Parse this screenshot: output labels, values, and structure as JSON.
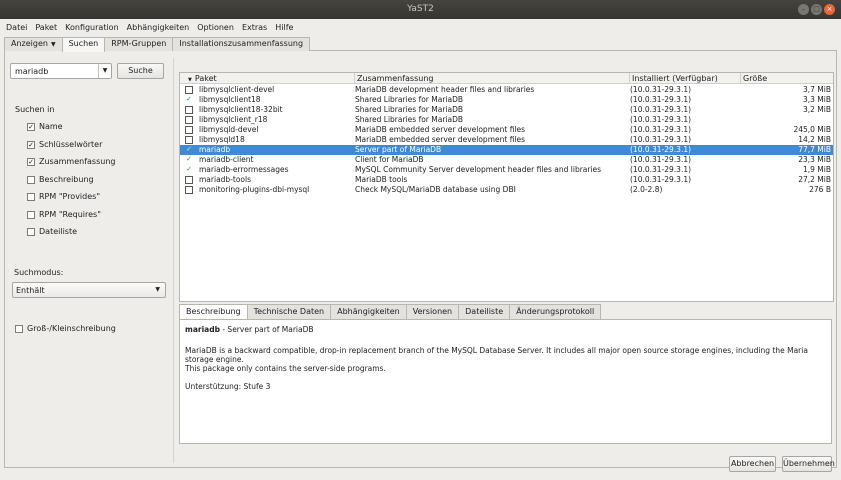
{
  "window": {
    "title": "YaST2"
  },
  "menu": [
    "Datei",
    "Paket",
    "Konfiguration",
    "Abhängigkeiten",
    "Optionen",
    "Extras",
    "Hilfe"
  ],
  "top_tabs": {
    "view": "Anzeigen",
    "search": "Suchen",
    "rpm_groups": "RPM-Gruppen",
    "install_summary": "Installationszusammenfassung"
  },
  "search": {
    "value": "mariadb",
    "button": "Suche",
    "search_in_label": "Suchen in",
    "options": [
      {
        "label": "Name",
        "checked": true
      },
      {
        "label": "Schlüsselwörter",
        "checked": true
      },
      {
        "label": "Zusammenfassung",
        "checked": true
      },
      {
        "label": "Beschreibung",
        "checked": false
      },
      {
        "label": "RPM \"Provides\"",
        "checked": false
      },
      {
        "label": "RPM \"Requires\"",
        "checked": false
      },
      {
        "label": "Dateiliste",
        "checked": false
      }
    ],
    "mode_label": "Suchmodus:",
    "mode_value": "Enthält",
    "case_label": "Groß-/Kleinschreibung",
    "case_checked": false
  },
  "table": {
    "headers": [
      "Paket",
      "Zusammenfassung",
      "Installiert (Verfügbar)",
      "Größe"
    ],
    "rows": [
      {
        "status": "none",
        "name": "libmysqlclient-devel",
        "summary": "MariaDB development header files and libraries",
        "version": "(10.0.31-29.3.1)",
        "size": "3,7 MiB"
      },
      {
        "status": "auto",
        "name": "libmysqlclient18",
        "summary": "Shared Libraries for MariaDB",
        "version": "(10.0.31-29.3.1)",
        "size": "3,3 MiB"
      },
      {
        "status": "none",
        "name": "libmysqlclient18-32bit",
        "summary": "Shared Libraries for MariaDB",
        "version": "(10.0.31-29.3.1)",
        "size": "3,2 MiB"
      },
      {
        "status": "none",
        "name": "libmysqlclient_r18",
        "summary": "Shared Libraries for MariaDB",
        "version": "(10.0.31-29.3.1)",
        "size": ""
      },
      {
        "status": "none",
        "name": "libmysqld-devel",
        "summary": "MariaDB embedded server development files",
        "version": "(10.0.31-29.3.1)",
        "size": "245,0 MiB"
      },
      {
        "status": "none",
        "name": "libmysqld18",
        "summary": "MariaDB embedded server development files",
        "version": "(10.0.31-29.3.1)",
        "size": "14,2 MiB"
      },
      {
        "status": "install",
        "name": "mariadb",
        "summary": "Server part of MariaDB",
        "version": "(10.0.31-29.3.1)",
        "size": "77,7 MiB",
        "selected": true
      },
      {
        "status": "auto",
        "name": "mariadb-client",
        "summary": "Client for MariaDB",
        "version": "(10.0.31-29.3.1)",
        "size": "23,3 MiB"
      },
      {
        "status": "auto",
        "name": "mariadb-errormessages",
        "summary": "MySQL Community Server development header files and libraries",
        "version": "(10.0.31-29.3.1)",
        "size": "1,9 MiB"
      },
      {
        "status": "none",
        "name": "mariadb-tools",
        "summary": "MariaDB tools",
        "version": "(10.0.31-29.3.1)",
        "size": "27,2 MiB"
      },
      {
        "status": "none",
        "name": "monitoring-plugins-dbi-mysql",
        "summary": "Check MySQL/MariaDB database using DBI",
        "version": "(2.0-2.8)",
        "size": "276 B"
      }
    ]
  },
  "detail_tabs": [
    "Beschreibung",
    "Technische Daten",
    "Abhängigkeiten",
    "Versionen",
    "Dateiliste",
    "Änderungsprotokoll"
  ],
  "description": {
    "name": "mariadb",
    "summary_suffix": " - Server part of MariaDB",
    "paragraph1": "MariaDB is a backward compatible, drop-in replacement branch of the MySQL Database Server. It includes all major open source storage engines, including the Maria storage engine.",
    "paragraph2": "This package only contains the server-side programs.",
    "support": "Unterstützung: Stufe 3"
  },
  "buttons": {
    "cancel": "Abbrechen",
    "accept": "Übernehmen"
  }
}
